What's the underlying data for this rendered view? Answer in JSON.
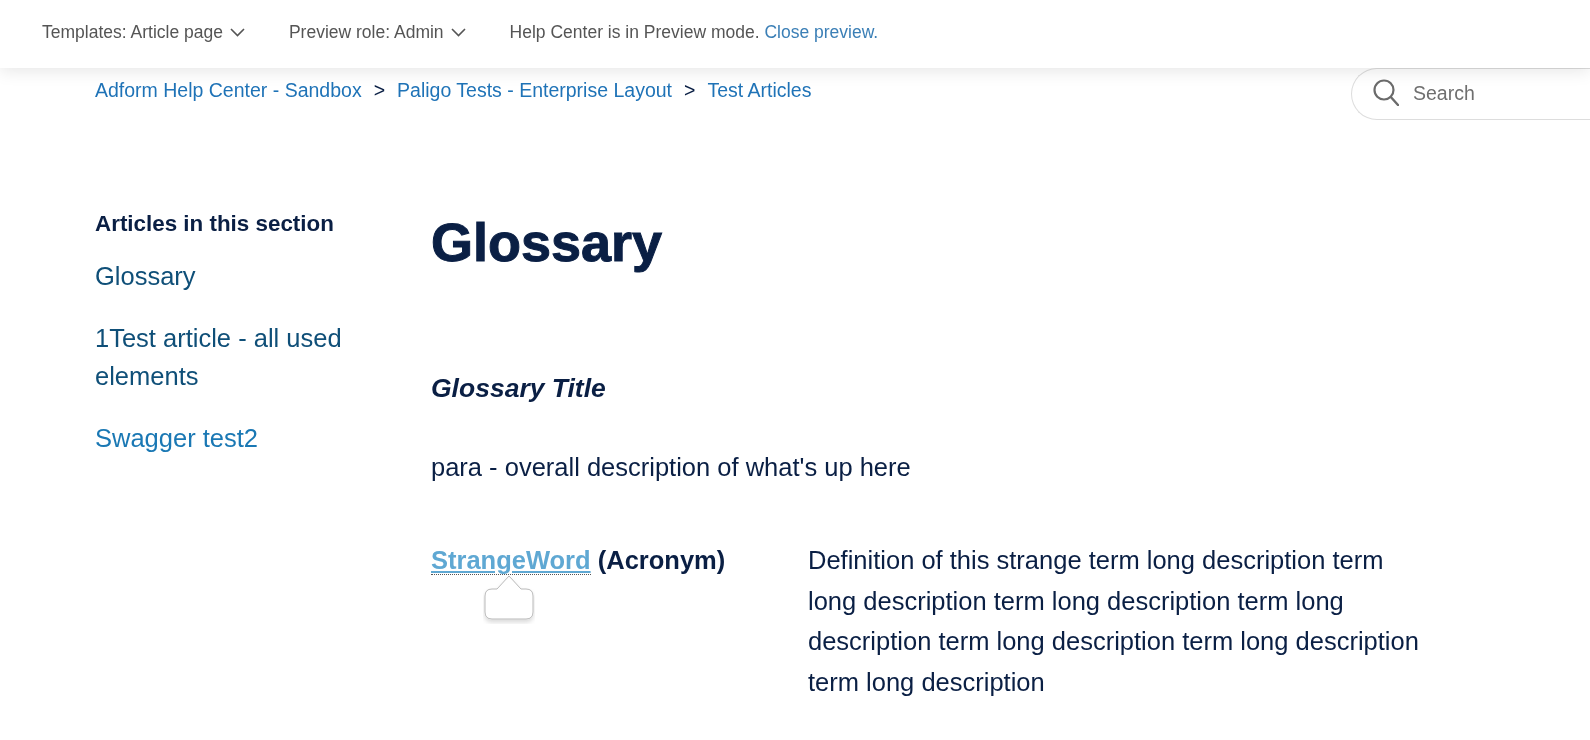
{
  "preview_bar": {
    "dropdowns": [
      {
        "label": "Templates: Article page"
      },
      {
        "label": "Preview role: Admin"
      }
    ],
    "notice": {
      "text": "Help Center is in Preview mode.",
      "link": "Close preview."
    }
  },
  "breadcrumb": [
    {
      "label": "Adform Help Center - Sandbox",
      "separator": ">"
    },
    {
      "label": "Paligo Tests - Enterprise Layout",
      "separator": ">"
    },
    {
      "label": "Test Articles"
    }
  ],
  "search": {
    "placeholder": "Search"
  },
  "sidebar": {
    "heading": "Articles in this section",
    "items": [
      {
        "label": "Glossary",
        "visited": true
      },
      {
        "label": "1Test article - all used elements",
        "visited": true
      },
      {
        "label": "Swagger test2",
        "visited": false
      }
    ]
  },
  "article": {
    "title": "Glossary",
    "glossary_title": "Glossary Title",
    "intro": "para - overall description of what's up here",
    "entries": [
      {
        "term": "StrangeWord",
        "qualifier": "(Acronym)",
        "definition": "Definition of this strange term long description term long description term long description term long description term long description term long description term long description",
        "tooltip_open": true
      }
    ]
  }
}
